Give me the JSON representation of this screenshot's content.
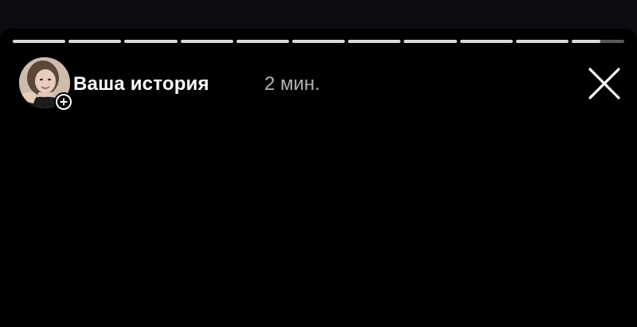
{
  "story": {
    "title": "Ваша история",
    "time": "2 мин.",
    "segments_total": 11,
    "segments_completed": 10,
    "current_segment_progress": 0.55
  },
  "icons": {
    "avatar": "profile-avatar",
    "add": "add-story-icon",
    "close": "close-icon"
  },
  "colors": {
    "background": "#000000",
    "progress_filled": "#d9d9d9",
    "title": "#ffffff",
    "time": "#b3b3b3"
  }
}
